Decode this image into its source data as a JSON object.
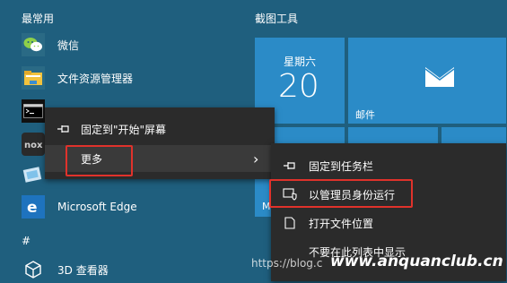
{
  "start": {
    "frequent_header": "最常用",
    "tiles_header": "截图工具",
    "section_hash": "#",
    "apps": [
      {
        "label": "微信",
        "icon": "wechat-icon"
      },
      {
        "label": "文件资源管理器",
        "icon": "file-explorer-icon"
      },
      {
        "label": "",
        "icon": "command-prompt-icon"
      },
      {
        "label": "",
        "icon": "nox-icon"
      },
      {
        "label": "",
        "icon": "app-icon"
      },
      {
        "label": "Microsoft Edge",
        "icon": "edge-icon"
      },
      {
        "label": "3D 查看器",
        "icon": "3d-viewer-icon"
      }
    ],
    "tiles": {
      "calendar_day": "星期六",
      "calendar_date": "20",
      "mail_label": "邮件",
      "partial_label": "M"
    }
  },
  "context_menu": {
    "pin_start": "固定到\"开始\"屏幕",
    "more": "更多",
    "more_chevron": "›"
  },
  "submenu": {
    "pin_taskbar": "固定到任务栏",
    "run_admin": "以管理员身份运行",
    "open_location": "打开文件位置",
    "hide_from_list": "不要在此列表中显示"
  },
  "watermark": {
    "url": "https://blog.c",
    "brand": "www.anquanclub.cn"
  },
  "colors": {
    "background": "#1f5f7e",
    "tile": "#2b8bc7",
    "menu": "#2b2b2b",
    "highlight": "#e0322b"
  }
}
